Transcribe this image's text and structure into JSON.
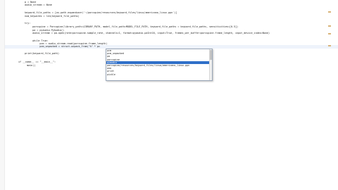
{
  "editor": {
    "lines": [
      {
        "text": "p = None"
      },
      {
        "text": "audio_stream = None"
      },
      {
        "text": ""
      },
      {
        "text": "keyword_file_paths = [os.path.expanduser('~/porcupine/resources/keyword_files/linux/americano_linux.ppn')]"
      },
      {
        "text": "num_keywords = len(keyword_file_paths)"
      },
      {
        "text": ""
      },
      {
        "text": "try:"
      },
      {
        "text": "    porcupine = Porcupine(library_path=LIBRARY_PATH, model_file_path=MODEL_FILE_PATH, keyword_file_paths = keyword_file_paths, sensitivities=[0.5])"
      },
      {
        "text": "    pa = pyaudio.PyAudio()"
      },
      {
        "text": "    audio_stream = pa.open(rate=porcupine.sample_rate, channels=1, format=pyaudio.paInt16, input=True, frames_per_buffer=porcupine.frame_length, input_device_index=None)"
      },
      {
        "text": ""
      },
      {
        "text": "    while True:"
      },
      {
        "text": "        pcm = audio_stream.read(porcupine.frame_length)"
      },
      {
        "text": "        pcm_unpacked = struct.unpack_from(\"h\" * pc"
      },
      {
        "text": ""
      },
      {
        "text": "print(keyword_file_path)"
      },
      {
        "text": ""
      },
      {
        "text": "if __name__ == \"__main__\":"
      },
      {
        "text": "    main()"
      }
    ]
  },
  "autocomplete": {
    "items": [
      {
        "label": "pcm"
      },
      {
        "label": "pcm_unpacked"
      },
      {
        "label": "pa"
      },
      {
        "label": "porcupine"
      },
      {
        "label": "pyaudio"
      },
      {
        "label": "porcupine/resources/keyword_files/linux/americano_linux.ppn"
      },
      {
        "label": "pow"
      },
      {
        "label": "print"
      },
      {
        "label": "pickle"
      }
    ],
    "selected_index": 4
  },
  "colors": {
    "selection": "#2f6fc8",
    "current_line": "#eef3fb",
    "keyword": "#000080",
    "string": "#008000"
  }
}
